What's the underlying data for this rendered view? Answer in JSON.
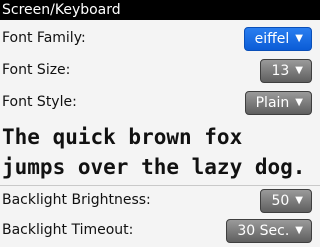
{
  "title": "Screen/Keyboard",
  "settings": {
    "font_family": {
      "label": "Font Family:",
      "value": "eiffel"
    },
    "font_size": {
      "label": "Font Size:",
      "value": "13"
    },
    "font_style": {
      "label": "Font Style:",
      "value": "Plain"
    },
    "backlight_brightness": {
      "label": "Backlight Brightness:",
      "value": "50"
    },
    "backlight_timeout": {
      "label": "Backlight Timeout:",
      "value": "30 Sec."
    }
  },
  "preview": {
    "line1": "The quick brown fox",
    "line2": "jumps over the lazy dog."
  },
  "caret_glyph": "▼",
  "colors": {
    "selected_accent": "#0b5cd6",
    "title_bar": "#000000"
  }
}
